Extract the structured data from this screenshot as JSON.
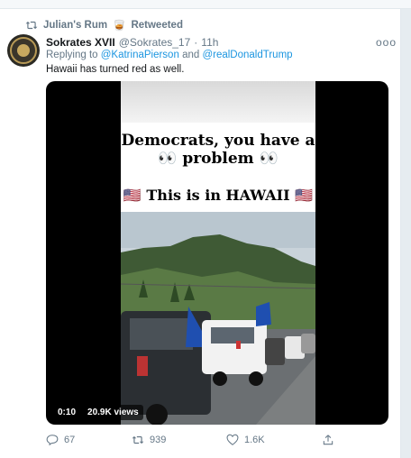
{
  "retweet_bar": {
    "icon": "retweet-icon",
    "user": "Julian's Rum",
    "emoji": "🥃",
    "label": "Retweeted"
  },
  "tweet": {
    "name": "Sokrates XVII",
    "handle": "@Sokrates_17",
    "dot": "·",
    "time": "11h",
    "more": "ooo",
    "reply_prefix": "Replying to",
    "reply_user1": "@KatrinaPierson",
    "reply_and": "and",
    "reply_user2": "@realDonaldTrump",
    "text": "Hawaii has turned red as well."
  },
  "video": {
    "line1": "Democrats, you have a",
    "line2": "👀 problem 👀",
    "line3": "🇺🇸 This is in HAWAII 🇺🇸",
    "duration": "0:10",
    "views": "20.9K views"
  },
  "actions": {
    "reply_icon": "reply-icon",
    "reply_count": "67",
    "retweet_icon": "retweet-icon",
    "retweet_count": "939",
    "like_icon": "heart-icon",
    "like_count": "1.6K",
    "share_icon": "share-icon"
  }
}
